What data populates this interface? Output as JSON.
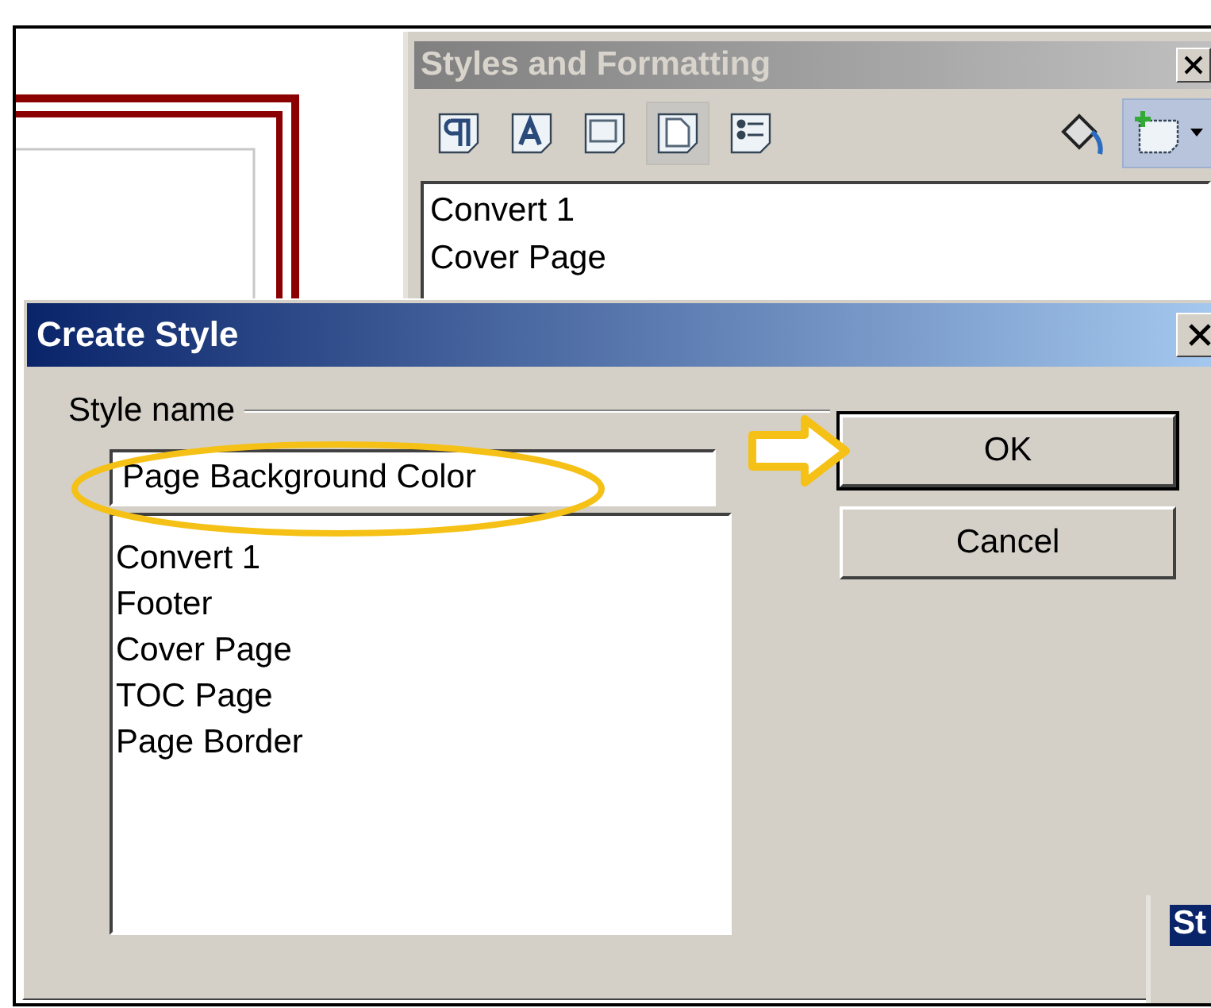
{
  "styles_panel": {
    "title": "Styles and Formatting",
    "categories": [
      {
        "kind": "paragraph",
        "selected": false
      },
      {
        "kind": "character",
        "selected": false
      },
      {
        "kind": "frame",
        "selected": false
      },
      {
        "kind": "page",
        "selected": true
      },
      {
        "kind": "list",
        "selected": false
      }
    ],
    "styles": [
      "Convert 1",
      "Cover Page"
    ]
  },
  "dialog": {
    "title": "Create Style",
    "field_label": "Style name",
    "style_name": "Page Background Color",
    "styles": [
      "Convert 1",
      "Footer",
      "Cover Page",
      "TOC Page",
      "Page Border"
    ],
    "buttons": [
      "OK",
      "Cancel"
    ]
  },
  "second_panel": {
    "title": "St"
  }
}
